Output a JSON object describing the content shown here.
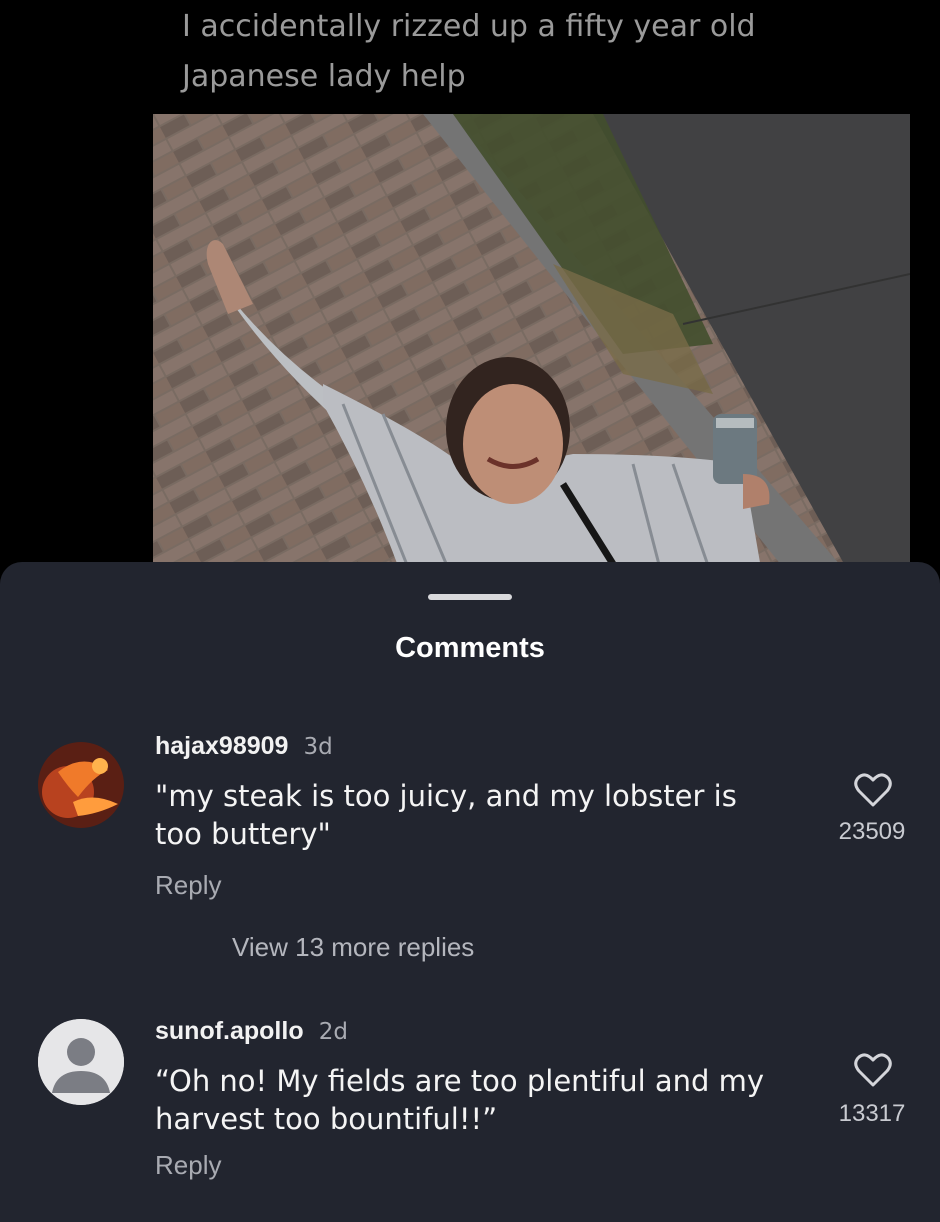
{
  "post": {
    "caption_line1": "I accidentally rizzed up a fifty year old",
    "caption_line2": "Japanese lady help"
  },
  "sheet": {
    "title": "Comments"
  },
  "comments": [
    {
      "username": "hajax98909",
      "age": "3d",
      "text_line1": "\"my steak is too juicy, and my lobster is",
      "text_line2": "too buttery\"",
      "reply_label": "Reply",
      "likes": "23509",
      "avatar": "orange-abstract-avatar"
    },
    {
      "username": "sunof.apollo",
      "age": "2d",
      "text_line1": "“Oh no! My fields are too plentiful and my",
      "text_line2": "harvest too bountiful!!”",
      "reply_label": "Reply",
      "likes": "13317",
      "avatar": "default-user-avatar"
    }
  ],
  "view_more_replies": "View 13 more replies",
  "icons": {
    "like": "heart-outline-icon"
  },
  "colors": {
    "sheet_background": "#22252f",
    "secondary_text": "#a9abb2"
  }
}
